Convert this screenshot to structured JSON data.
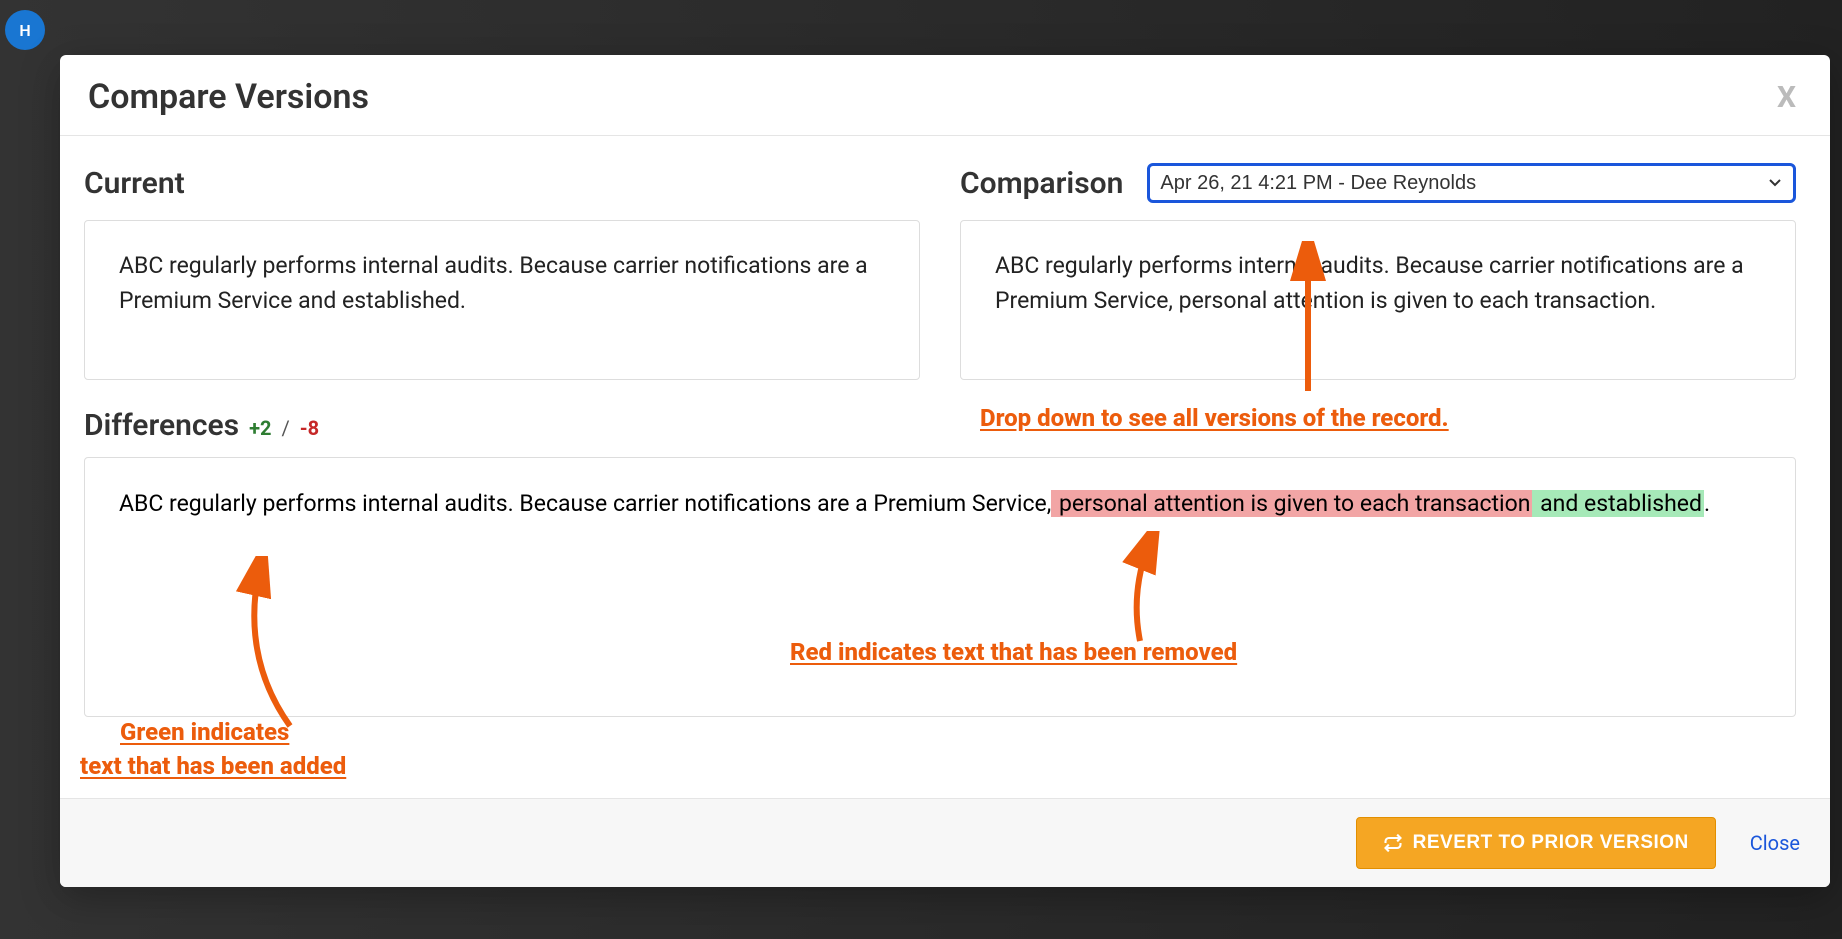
{
  "modal": {
    "title": "Compare Versions",
    "close_x": "X",
    "current_label": "Current",
    "comparison_label": "Comparison",
    "version_selected": "Apr 26, 21 4:21 PM - Dee Reynolds",
    "current_text": "ABC regularly performs internal audits. Because carrier notifications are a Premium Service and established.",
    "comparison_text": "ABC regularly performs internal audits. Because carrier notifications are a Premium Service, personal attention is given to each transaction.",
    "differences_label": "Differences",
    "diff_added": "+2",
    "diff_slash": "/",
    "diff_removed": "-8",
    "diff_body": {
      "pre": "ABC regularly performs internal audits. Because carrier notifications are a Premium Service,",
      "removed": " personal attention is given to each transaction",
      "added1": " and established",
      "post": "."
    },
    "revert_label": "REVERT TO PRIOR VERSION",
    "close_label": "Close"
  },
  "annotations": {
    "dropdown": "Drop down to see all versions of the record.",
    "red": "Red indicates text that has been removed",
    "green_line1": "Green indicates",
    "green_line2": "text that has been added"
  },
  "colors": {
    "accent_orange": "#ec5c0c",
    "select_border": "#1a56db",
    "btn_bg": "#f5a623",
    "hl_red": "#f2a5a5",
    "hl_green": "#a6e9b8"
  }
}
